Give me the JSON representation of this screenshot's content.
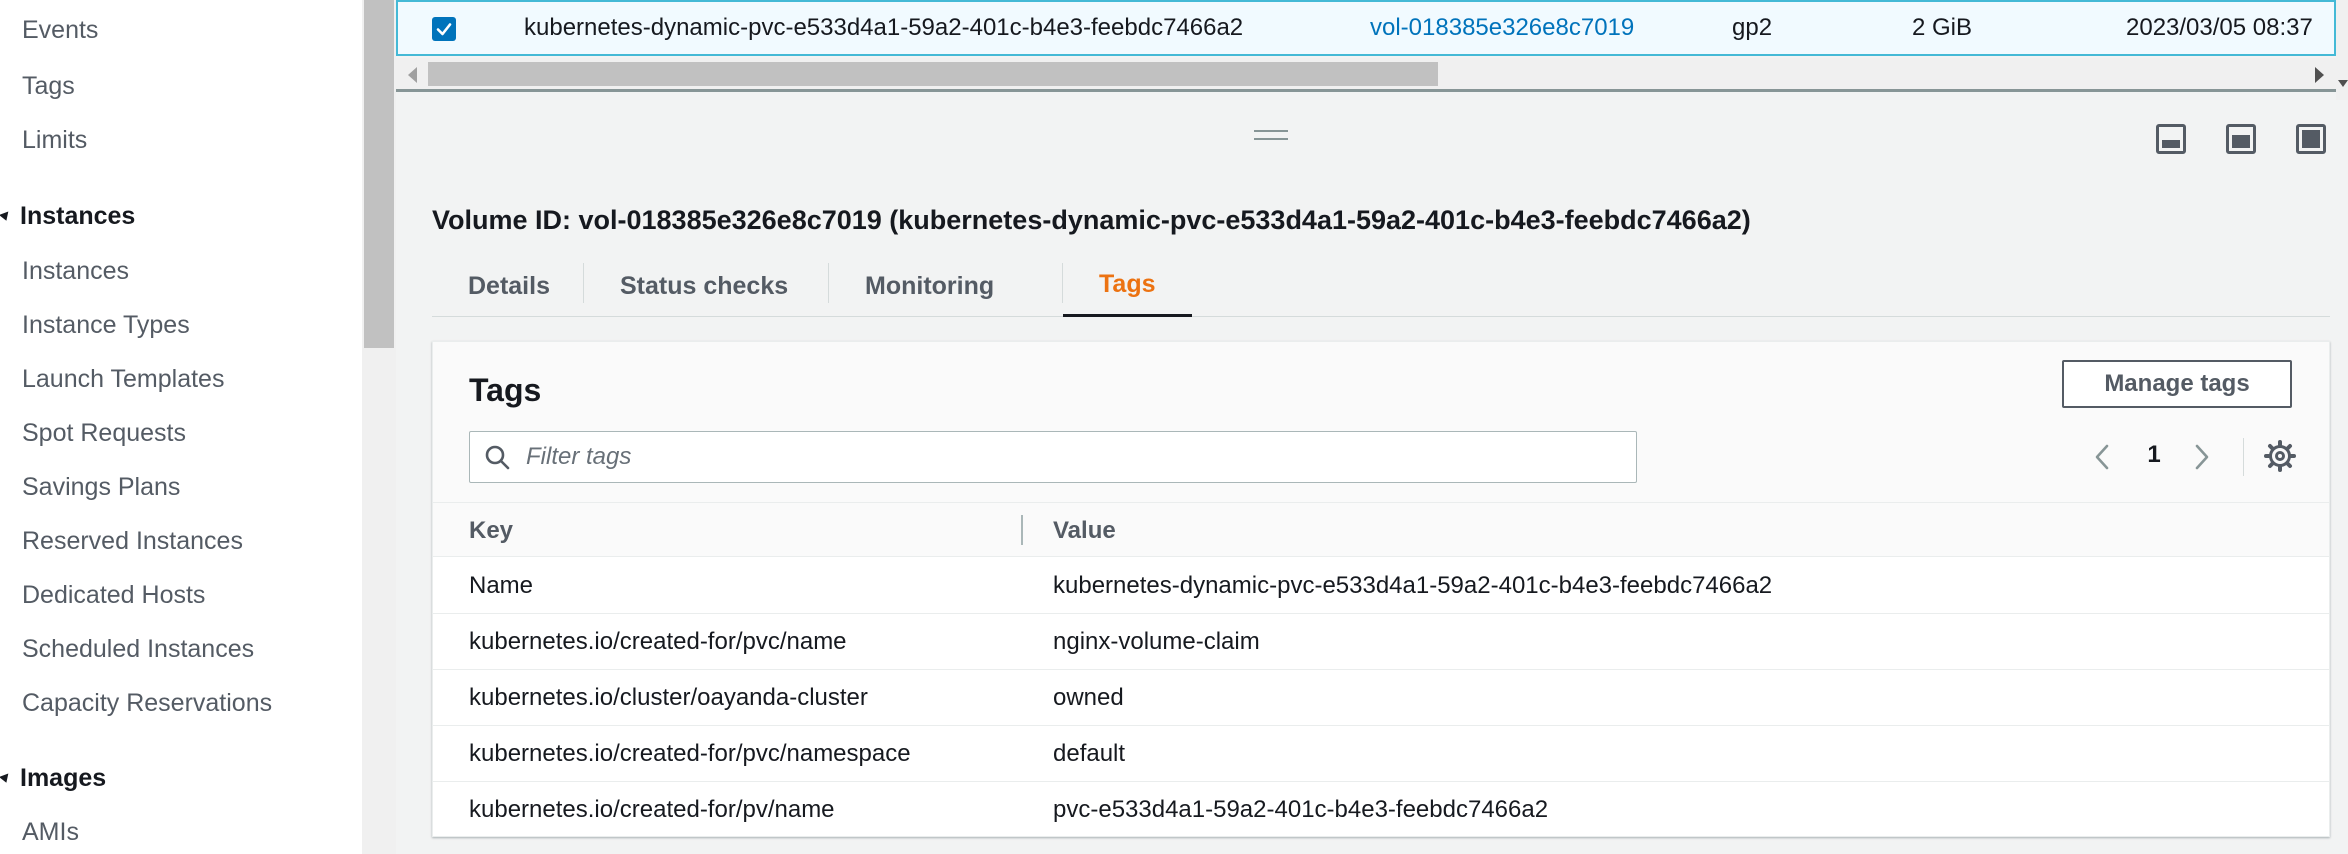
{
  "sidebar": {
    "items_top": [
      "Events",
      "Tags",
      "Limits"
    ],
    "section_instances": "Instances",
    "instances_items": [
      "Instances",
      "Instance Types",
      "Launch Templates",
      "Spot Requests",
      "Savings Plans",
      "Reserved Instances",
      "Dedicated Hosts",
      "Scheduled Instances",
      "Capacity Reservations"
    ],
    "section_images": "Images",
    "images_items": [
      "AMIs"
    ]
  },
  "selected_row": {
    "checked": true,
    "name": "kubernetes-dynamic-pvc-e533d4a1-59a2-401c-b4e3-feebdc7466a2",
    "volume_id": "vol-018385e326e8c7019",
    "type": "gp2",
    "size": "2 GiB",
    "created": "2023/03/05 08:37"
  },
  "details": {
    "title": "Volume ID: vol-018385e326e8c7019 (kubernetes-dynamic-pvc-e533d4a1-59a2-401c-b4e3-feebdc7466a2)",
    "tabs": [
      "Details",
      "Status checks",
      "Monitoring",
      "Tags"
    ],
    "active_tab": "Tags"
  },
  "tags_panel": {
    "heading": "Tags",
    "manage_button": "Manage tags",
    "filter_placeholder": "Filter tags",
    "page": "1",
    "columns": [
      "Key",
      "Value"
    ],
    "rows": [
      {
        "key": "Name",
        "value": "kubernetes-dynamic-pvc-e533d4a1-59a2-401c-b4e3-feebdc7466a2"
      },
      {
        "key": "kubernetes.io/created-for/pvc/name",
        "value": "nginx-volume-claim"
      },
      {
        "key": "kubernetes.io/cluster/oayanda-cluster",
        "value": "owned"
      },
      {
        "key": "kubernetes.io/created-for/pvc/namespace",
        "value": "default"
      },
      {
        "key": "kubernetes.io/created-for/pv/name",
        "value": "pvc-e533d4a1-59a2-401c-b4e3-feebdc7466a2"
      }
    ]
  },
  "colors": {
    "link": "#0073bb",
    "active_tab": "#ec7211",
    "selected_row_bg": "#f1faff",
    "selected_row_border": "#44b9d6"
  },
  "icons": [
    "checkbox-checked-icon",
    "search-icon",
    "chevron-left-icon",
    "chevron-right-icon",
    "gear-icon",
    "panel-bottom-icon",
    "panel-side-icon",
    "panel-full-icon",
    "drag-handle-icon"
  ]
}
